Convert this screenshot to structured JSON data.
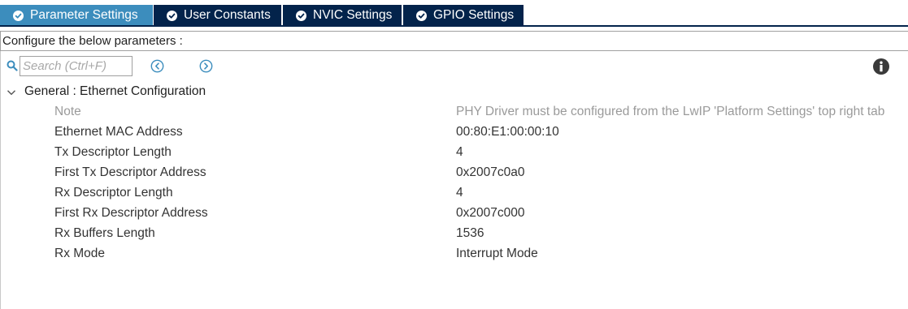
{
  "tabs": [
    {
      "label": "Parameter Settings",
      "active": true
    },
    {
      "label": "User Constants",
      "active": false
    },
    {
      "label": "NVIC Settings",
      "active": false
    },
    {
      "label": "GPIO Settings",
      "active": false
    }
  ],
  "configure_label": "Configure the below parameters :",
  "search": {
    "placeholder": "Search (Ctrl+F)",
    "value": ""
  },
  "group": {
    "title": "General : Ethernet Configuration",
    "expanded": true
  },
  "parameters": [
    {
      "name": "Note",
      "value": "PHY Driver must be configured from the LwIP 'Platform Settings' top right tab",
      "muted": true
    },
    {
      "name": "Ethernet MAC Address",
      "value": "00:80:E1:00:00:10"
    },
    {
      "name": "Tx Descriptor Length",
      "value": "4"
    },
    {
      "name": "First Tx Descriptor Address",
      "value": "0x2007c0a0"
    },
    {
      "name": "Rx Descriptor Length",
      "value": "4"
    },
    {
      "name": "First Rx Descriptor Address",
      "value": "0x2007c000"
    },
    {
      "name": "Rx Buffers Length",
      "value": "1536"
    },
    {
      "name": "Rx Mode",
      "value": "Interrupt Mode"
    }
  ],
  "colors": {
    "tab_active": "#3c8dbd",
    "tab_inactive": "#03234b",
    "nav_icon": "#3c8dbd"
  },
  "icons": {
    "tab_status": "check-circle-icon",
    "search": "search-icon",
    "prev": "chevron-left-circle-icon",
    "next": "chevron-right-circle-icon",
    "info": "info-icon",
    "expand": "chevron-down-icon"
  }
}
